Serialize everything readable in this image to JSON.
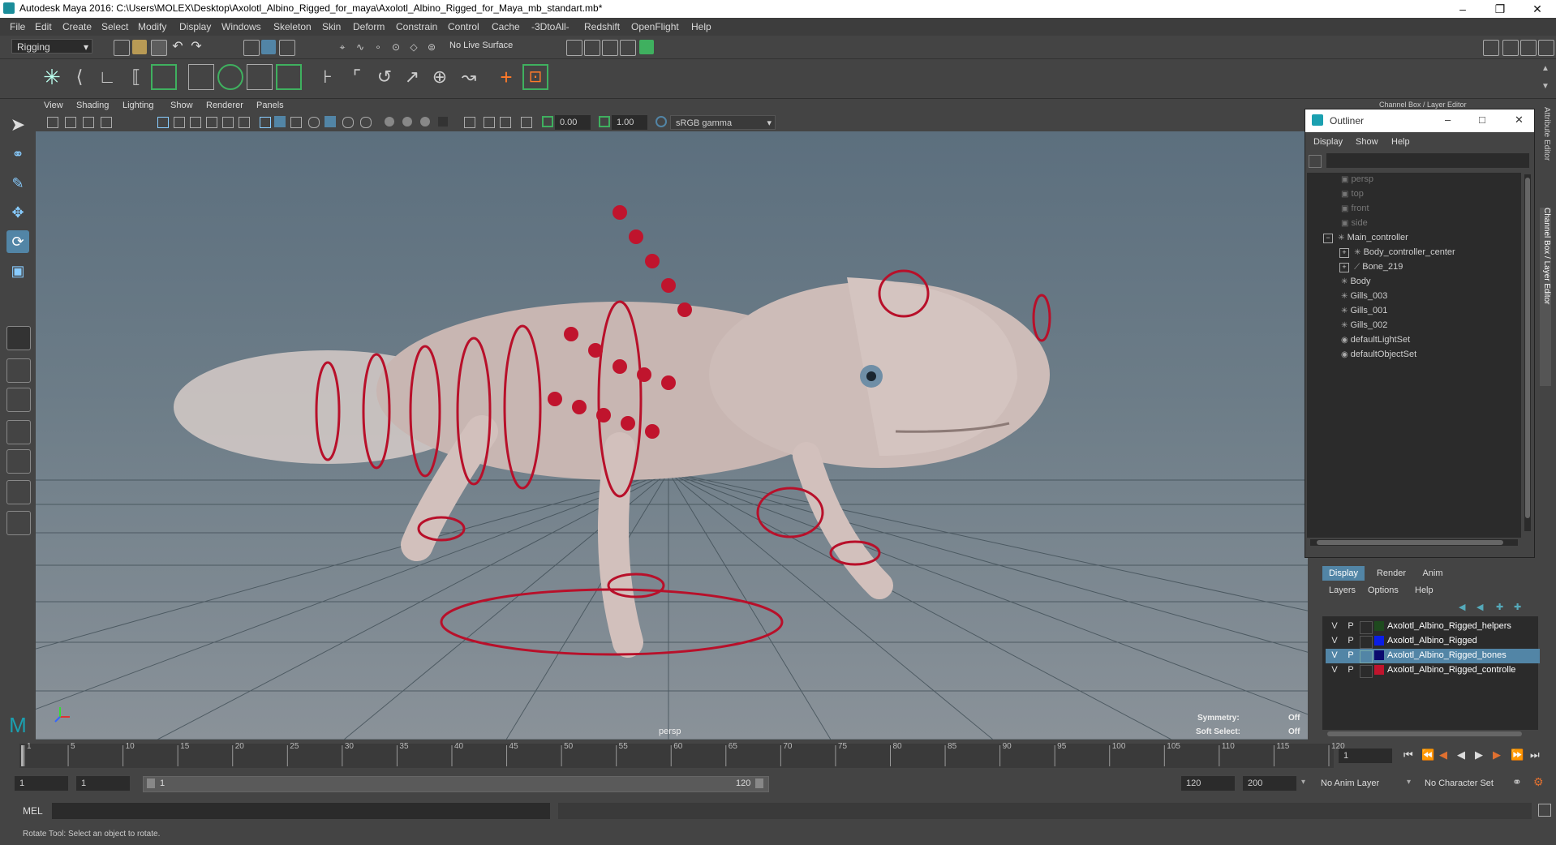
{
  "window": {
    "title": "Autodesk Maya 2016: C:\\Users\\MOLEX\\Desktop\\Axolotl_Albino_Rigged_for_maya\\Axolotl_Albino_Rigged_for_Maya_mb_standart.mb*"
  },
  "menubar": [
    "File",
    "Edit",
    "Create",
    "Select",
    "Modify",
    "Display",
    "Windows",
    "Skeleton",
    "Skin",
    "Deform",
    "Constrain",
    "Control",
    "Cache",
    "-3DtoAll-",
    "Redshift",
    "OpenFlight",
    "Help"
  ],
  "statusline": {
    "mode": "Rigging",
    "live_surface": "No Live Surface"
  },
  "viewport": {
    "menus": [
      "View",
      "Shading",
      "Lighting",
      "Show",
      "Renderer",
      "Panels"
    ],
    "exposure": "0.00",
    "gamma": "1.00",
    "color_space": "sRGB gamma",
    "camera_label": "persp",
    "symmetry_label": "Symmetry:",
    "symmetry_value": "Off",
    "soft_select_label": "Soft Select:",
    "soft_select_value": "Off"
  },
  "channel_box": {
    "header": "Channel Box / Layer Editor",
    "side_tabs": [
      "Attribute Editor",
      "Channel Box / Layer Editor"
    ]
  },
  "outliner": {
    "title": "Outliner",
    "menus": [
      "Display",
      "Show",
      "Help"
    ],
    "items": [
      {
        "label": "persp",
        "icon": "camera-icon",
        "dim": true
      },
      {
        "label": "top",
        "icon": "camera-icon",
        "dim": true
      },
      {
        "label": "front",
        "icon": "camera-icon",
        "dim": true
      },
      {
        "label": "side",
        "icon": "camera-icon",
        "dim": true
      },
      {
        "label": "Main_controller",
        "icon": "transform-icon",
        "expand": "minus"
      },
      {
        "label": "Body_controller_center",
        "icon": "transform-icon",
        "expand": "plus"
      },
      {
        "label": "Bone_219",
        "icon": "joint-icon",
        "expand": "plus"
      },
      {
        "label": "Body",
        "icon": "transform-icon"
      },
      {
        "label": "Gills_003",
        "icon": "transform-icon"
      },
      {
        "label": "Gills_001",
        "icon": "transform-icon"
      },
      {
        "label": "Gills_002",
        "icon": "transform-icon"
      },
      {
        "label": "defaultLightSet",
        "icon": "set-icon"
      },
      {
        "label": "defaultObjectSet",
        "icon": "set-icon"
      }
    ]
  },
  "layer_editor": {
    "tabs": [
      "Display",
      "Render",
      "Anim"
    ],
    "active_tab": "Display",
    "menus": [
      "Layers",
      "Options",
      "Help"
    ],
    "layers": [
      {
        "v": "V",
        "p": "P",
        "color": "#1e4a1e",
        "name": "Axolotl_Albino_Rigged_helpers",
        "selected": false
      },
      {
        "v": "V",
        "p": "P",
        "color": "#0a1ee6",
        "name": "Axolotl_Albino_Rigged",
        "selected": false
      },
      {
        "v": "V",
        "p": "P",
        "color": "#0a0a6e",
        "name": "Axolotl_Albino_Rigged_bones",
        "selected": true
      },
      {
        "v": "V",
        "p": "P",
        "color": "#c0142d",
        "name": "Axolotl_Albino_Rigged_controlle",
        "selected": false
      }
    ]
  },
  "timeline": {
    "ticks": [
      "1",
      "5",
      "10",
      "15",
      "20",
      "25",
      "30",
      "35",
      "40",
      "45",
      "50",
      "55",
      "60",
      "65",
      "70",
      "75",
      "80",
      "85",
      "90",
      "95",
      "100",
      "105",
      "110",
      "115",
      "120"
    ],
    "current_frame": "1"
  },
  "range": {
    "start": "1",
    "inner_start": "1",
    "slider_start": "1",
    "slider_end": "120",
    "end": "120",
    "outer_end": "200",
    "anim_layer": "No Anim Layer",
    "character_set": "No Character Set"
  },
  "command_line": {
    "lang": "MEL"
  },
  "help_line": {
    "text": "Rotate Tool: Select an object to rotate."
  },
  "colors": {
    "rig_red": "#b8102a",
    "selection": "#5285a6",
    "panel": "#444444",
    "field": "#2b2b2b"
  }
}
